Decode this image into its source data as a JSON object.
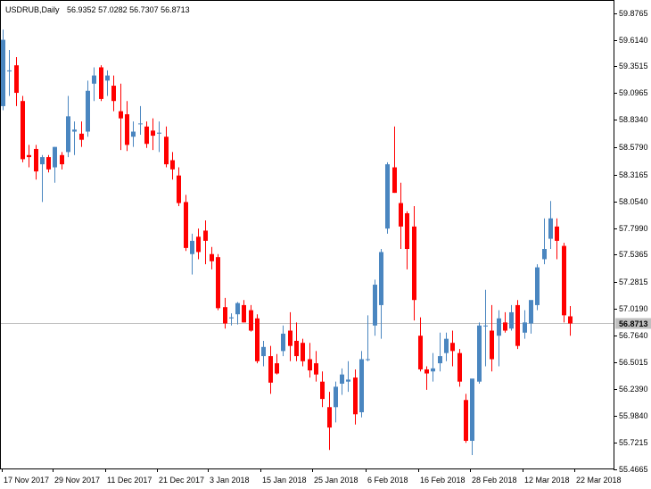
{
  "chart_data": {
    "type": "candlestick",
    "symbol_header": "USDRUB,Daily",
    "header_values": "56.9352 57.0282 56.7307 56.8713",
    "current_price": 56.8713,
    "current_price_label": "56.8713",
    "ylim": [
      55.4665,
      59.9
    ],
    "grid": false,
    "colors": {
      "up": "#4a86c0",
      "down": "#ff0000",
      "current_line": "#c0c0c0",
      "label_bg": "#c0c0c0"
    },
    "y_ticks": [
      "59.8765",
      "59.6140",
      "59.3515",
      "59.0965",
      "58.8340",
      "58.5790",
      "58.3165",
      "58.0540",
      "57.7990",
      "57.5365",
      "57.2815",
      "57.0190",
      "56.7640",
      "56.5015",
      "56.2390",
      "55.9840",
      "55.7215",
      "55.4665"
    ],
    "x_ticks": [
      "17 Nov 2017",
      "29 Nov 2017",
      "11 Dec 2017",
      "21 Dec 2017",
      "3 Jan 2018",
      "15 Jan 2018",
      "25 Jan 2018",
      "6 Feb 2018",
      "16 Feb 2018",
      "28 Feb 2018",
      "12 Mar 2018",
      "22 Mar 2018"
    ],
    "candles": [
      {
        "o": 59.0,
        "h": 59.75,
        "l": 58.96,
        "c": 59.65
      },
      {
        "o": 59.34,
        "h": 59.55,
        "l": 59.1,
        "c": 59.35
      },
      {
        "o": 59.4,
        "h": 59.48,
        "l": 59.0,
        "c": 59.13
      },
      {
        "o": 59.05,
        "h": 59.1,
        "l": 58.45,
        "c": 58.48
      },
      {
        "o": 58.52,
        "h": 58.62,
        "l": 58.4,
        "c": 58.5
      },
      {
        "o": 58.58,
        "h": 58.62,
        "l": 58.28,
        "c": 58.36
      },
      {
        "o": 58.43,
        "h": 58.52,
        "l": 58.06,
        "c": 58.5
      },
      {
        "o": 58.5,
        "h": 58.52,
        "l": 58.35,
        "c": 58.38
      },
      {
        "o": 58.4,
        "h": 58.6,
        "l": 58.25,
        "c": 58.6
      },
      {
        "o": 58.52,
        "h": 58.55,
        "l": 58.38,
        "c": 58.43
      },
      {
        "o": 58.55,
        "h": 59.1,
        "l": 58.5,
        "c": 58.9
      },
      {
        "o": 58.75,
        "h": 58.85,
        "l": 58.52,
        "c": 58.77
      },
      {
        "o": 58.73,
        "h": 58.85,
        "l": 58.6,
        "c": 58.67
      },
      {
        "o": 58.75,
        "h": 59.25,
        "l": 58.7,
        "c": 59.15
      },
      {
        "o": 59.22,
        "h": 59.38,
        "l": 59.05,
        "c": 59.3
      },
      {
        "o": 59.38,
        "h": 59.4,
        "l": 59.05,
        "c": 59.07
      },
      {
        "o": 59.25,
        "h": 59.35,
        "l": 59.1,
        "c": 59.3
      },
      {
        "o": 59.2,
        "h": 59.3,
        "l": 58.95,
        "c": 59.05
      },
      {
        "o": 58.95,
        "h": 59.22,
        "l": 58.57,
        "c": 58.88
      },
      {
        "o": 58.92,
        "h": 59.05,
        "l": 58.56,
        "c": 58.62
      },
      {
        "o": 58.7,
        "h": 58.85,
        "l": 58.6,
        "c": 58.75
      },
      {
        "o": 58.83,
        "h": 59.0,
        "l": 58.72,
        "c": 58.83
      },
      {
        "o": 58.8,
        "h": 58.85,
        "l": 58.59,
        "c": 58.63
      },
      {
        "o": 58.76,
        "h": 58.88,
        "l": 58.57,
        "c": 58.71
      },
      {
        "o": 58.73,
        "h": 58.85,
        "l": 58.55,
        "c": 58.74
      },
      {
        "o": 58.7,
        "h": 58.8,
        "l": 58.4,
        "c": 58.43
      },
      {
        "o": 58.47,
        "h": 58.55,
        "l": 58.28,
        "c": 58.38
      },
      {
        "o": 58.32,
        "h": 58.4,
        "l": 58.02,
        "c": 58.05
      },
      {
        "o": 58.06,
        "h": 58.13,
        "l": 57.58,
        "c": 57.61
      },
      {
        "o": 57.55,
        "h": 57.75,
        "l": 57.35,
        "c": 57.68
      },
      {
        "o": 57.72,
        "h": 57.8,
        "l": 57.5,
        "c": 57.57
      },
      {
        "o": 57.78,
        "h": 57.88,
        "l": 57.45,
        "c": 57.68
      },
      {
        "o": 57.55,
        "h": 57.62,
        "l": 57.4,
        "c": 57.48
      },
      {
        "o": 57.52,
        "h": 57.55,
        "l": 57.0,
        "c": 57.02
      },
      {
        "o": 57.03,
        "h": 57.12,
        "l": 56.82,
        "c": 56.87
      },
      {
        "o": 56.92,
        "h": 56.97,
        "l": 56.85,
        "c": 56.93
      },
      {
        "o": 56.96,
        "h": 57.08,
        "l": 56.86,
        "c": 57.07
      },
      {
        "o": 57.05,
        "h": 57.1,
        "l": 56.88,
        "c": 56.88
      },
      {
        "o": 57.0,
        "h": 57.05,
        "l": 56.79,
        "c": 56.8
      },
      {
        "o": 56.92,
        "h": 56.96,
        "l": 56.48,
        "c": 56.5
      },
      {
        "o": 56.55,
        "h": 56.7,
        "l": 56.45,
        "c": 56.64
      },
      {
        "o": 56.55,
        "h": 56.65,
        "l": 56.18,
        "c": 56.29
      },
      {
        "o": 56.48,
        "h": 56.57,
        "l": 56.37,
        "c": 56.38
      },
      {
        "o": 56.6,
        "h": 56.85,
        "l": 56.55,
        "c": 56.77
      },
      {
        "o": 56.8,
        "h": 56.98,
        "l": 56.5,
        "c": 56.65
      },
      {
        "o": 56.7,
        "h": 56.88,
        "l": 56.5,
        "c": 56.55
      },
      {
        "o": 56.68,
        "h": 56.72,
        "l": 56.45,
        "c": 56.5
      },
      {
        "o": 56.52,
        "h": 56.68,
        "l": 56.34,
        "c": 56.41
      },
      {
        "o": 56.48,
        "h": 56.6,
        "l": 56.3,
        "c": 56.37
      },
      {
        "o": 56.3,
        "h": 56.4,
        "l": 56.05,
        "c": 56.13
      },
      {
        "o": 56.05,
        "h": 56.2,
        "l": 55.63,
        "c": 55.85
      },
      {
        "o": 56.05,
        "h": 56.3,
        "l": 55.9,
        "c": 56.25
      },
      {
        "o": 56.28,
        "h": 56.43,
        "l": 56.17,
        "c": 56.37
      },
      {
        "o": 56.3,
        "h": 56.5,
        "l": 56.2,
        "c": 56.32
      },
      {
        "o": 56.34,
        "h": 56.42,
        "l": 55.88,
        "c": 55.98
      },
      {
        "o": 56.0,
        "h": 56.6,
        "l": 55.95,
        "c": 56.52
      },
      {
        "o": 56.52,
        "h": 56.95,
        "l": 56.5,
        "c": 56.52
      },
      {
        "o": 56.85,
        "h": 57.3,
        "l": 56.75,
        "c": 57.25
      },
      {
        "o": 57.05,
        "h": 57.6,
        "l": 56.72,
        "c": 57.57
      },
      {
        "o": 57.8,
        "h": 58.45,
        "l": 57.75,
        "c": 58.43
      },
      {
        "o": 58.4,
        "h": 58.8,
        "l": 58.15,
        "c": 58.15
      },
      {
        "o": 58.05,
        "h": 58.25,
        "l": 57.6,
        "c": 57.82
      },
      {
        "o": 57.95,
        "h": 57.97,
        "l": 57.4,
        "c": 57.6
      },
      {
        "o": 57.82,
        "h": 58.02,
        "l": 56.9,
        "c": 57.1
      },
      {
        "o": 56.75,
        "h": 56.93,
        "l": 56.4,
        "c": 56.42
      },
      {
        "o": 56.42,
        "h": 56.45,
        "l": 56.22,
        "c": 56.38
      },
      {
        "o": 56.4,
        "h": 56.58,
        "l": 56.3,
        "c": 56.43
      },
      {
        "o": 56.48,
        "h": 56.78,
        "l": 56.4,
        "c": 56.55
      },
      {
        "o": 56.58,
        "h": 56.78,
        "l": 56.5,
        "c": 56.72
      },
      {
        "o": 56.68,
        "h": 56.8,
        "l": 56.45,
        "c": 56.6
      },
      {
        "o": 56.58,
        "h": 56.62,
        "l": 56.25,
        "c": 56.3
      },
      {
        "o": 56.12,
        "h": 56.18,
        "l": 55.7,
        "c": 55.72
      },
      {
        "o": 55.72,
        "h": 56.3,
        "l": 55.58,
        "c": 56.33
      },
      {
        "o": 56.3,
        "h": 56.88,
        "l": 56.28,
        "c": 56.85
      },
      {
        "o": 56.85,
        "h": 57.2,
        "l": 56.45,
        "c": 56.85
      },
      {
        "o": 56.8,
        "h": 57.05,
        "l": 56.4,
        "c": 56.52
      },
      {
        "o": 56.75,
        "h": 57.0,
        "l": 56.45,
        "c": 56.92
      },
      {
        "o": 56.88,
        "h": 56.98,
        "l": 56.78,
        "c": 56.8
      },
      {
        "o": 56.82,
        "h": 57.05,
        "l": 56.8,
        "c": 56.98
      },
      {
        "o": 57.05,
        "h": 57.1,
        "l": 56.62,
        "c": 56.65
      },
      {
        "o": 56.78,
        "h": 57.0,
        "l": 56.72,
        "c": 56.88
      },
      {
        "o": 56.87,
        "h": 57.08,
        "l": 56.77,
        "c": 57.1
      },
      {
        "o": 57.05,
        "h": 57.45,
        "l": 57.0,
        "c": 57.42
      },
      {
        "o": 57.5,
        "h": 57.9,
        "l": 57.45,
        "c": 57.6
      },
      {
        "o": 57.7,
        "h": 58.07,
        "l": 57.6,
        "c": 57.9
      },
      {
        "o": 57.82,
        "h": 57.9,
        "l": 57.5,
        "c": 57.68
      },
      {
        "o": 57.63,
        "h": 57.66,
        "l": 56.88,
        "c": 56.95
      },
      {
        "o": 56.94,
        "h": 57.04,
        "l": 56.75,
        "c": 56.87
      }
    ]
  }
}
